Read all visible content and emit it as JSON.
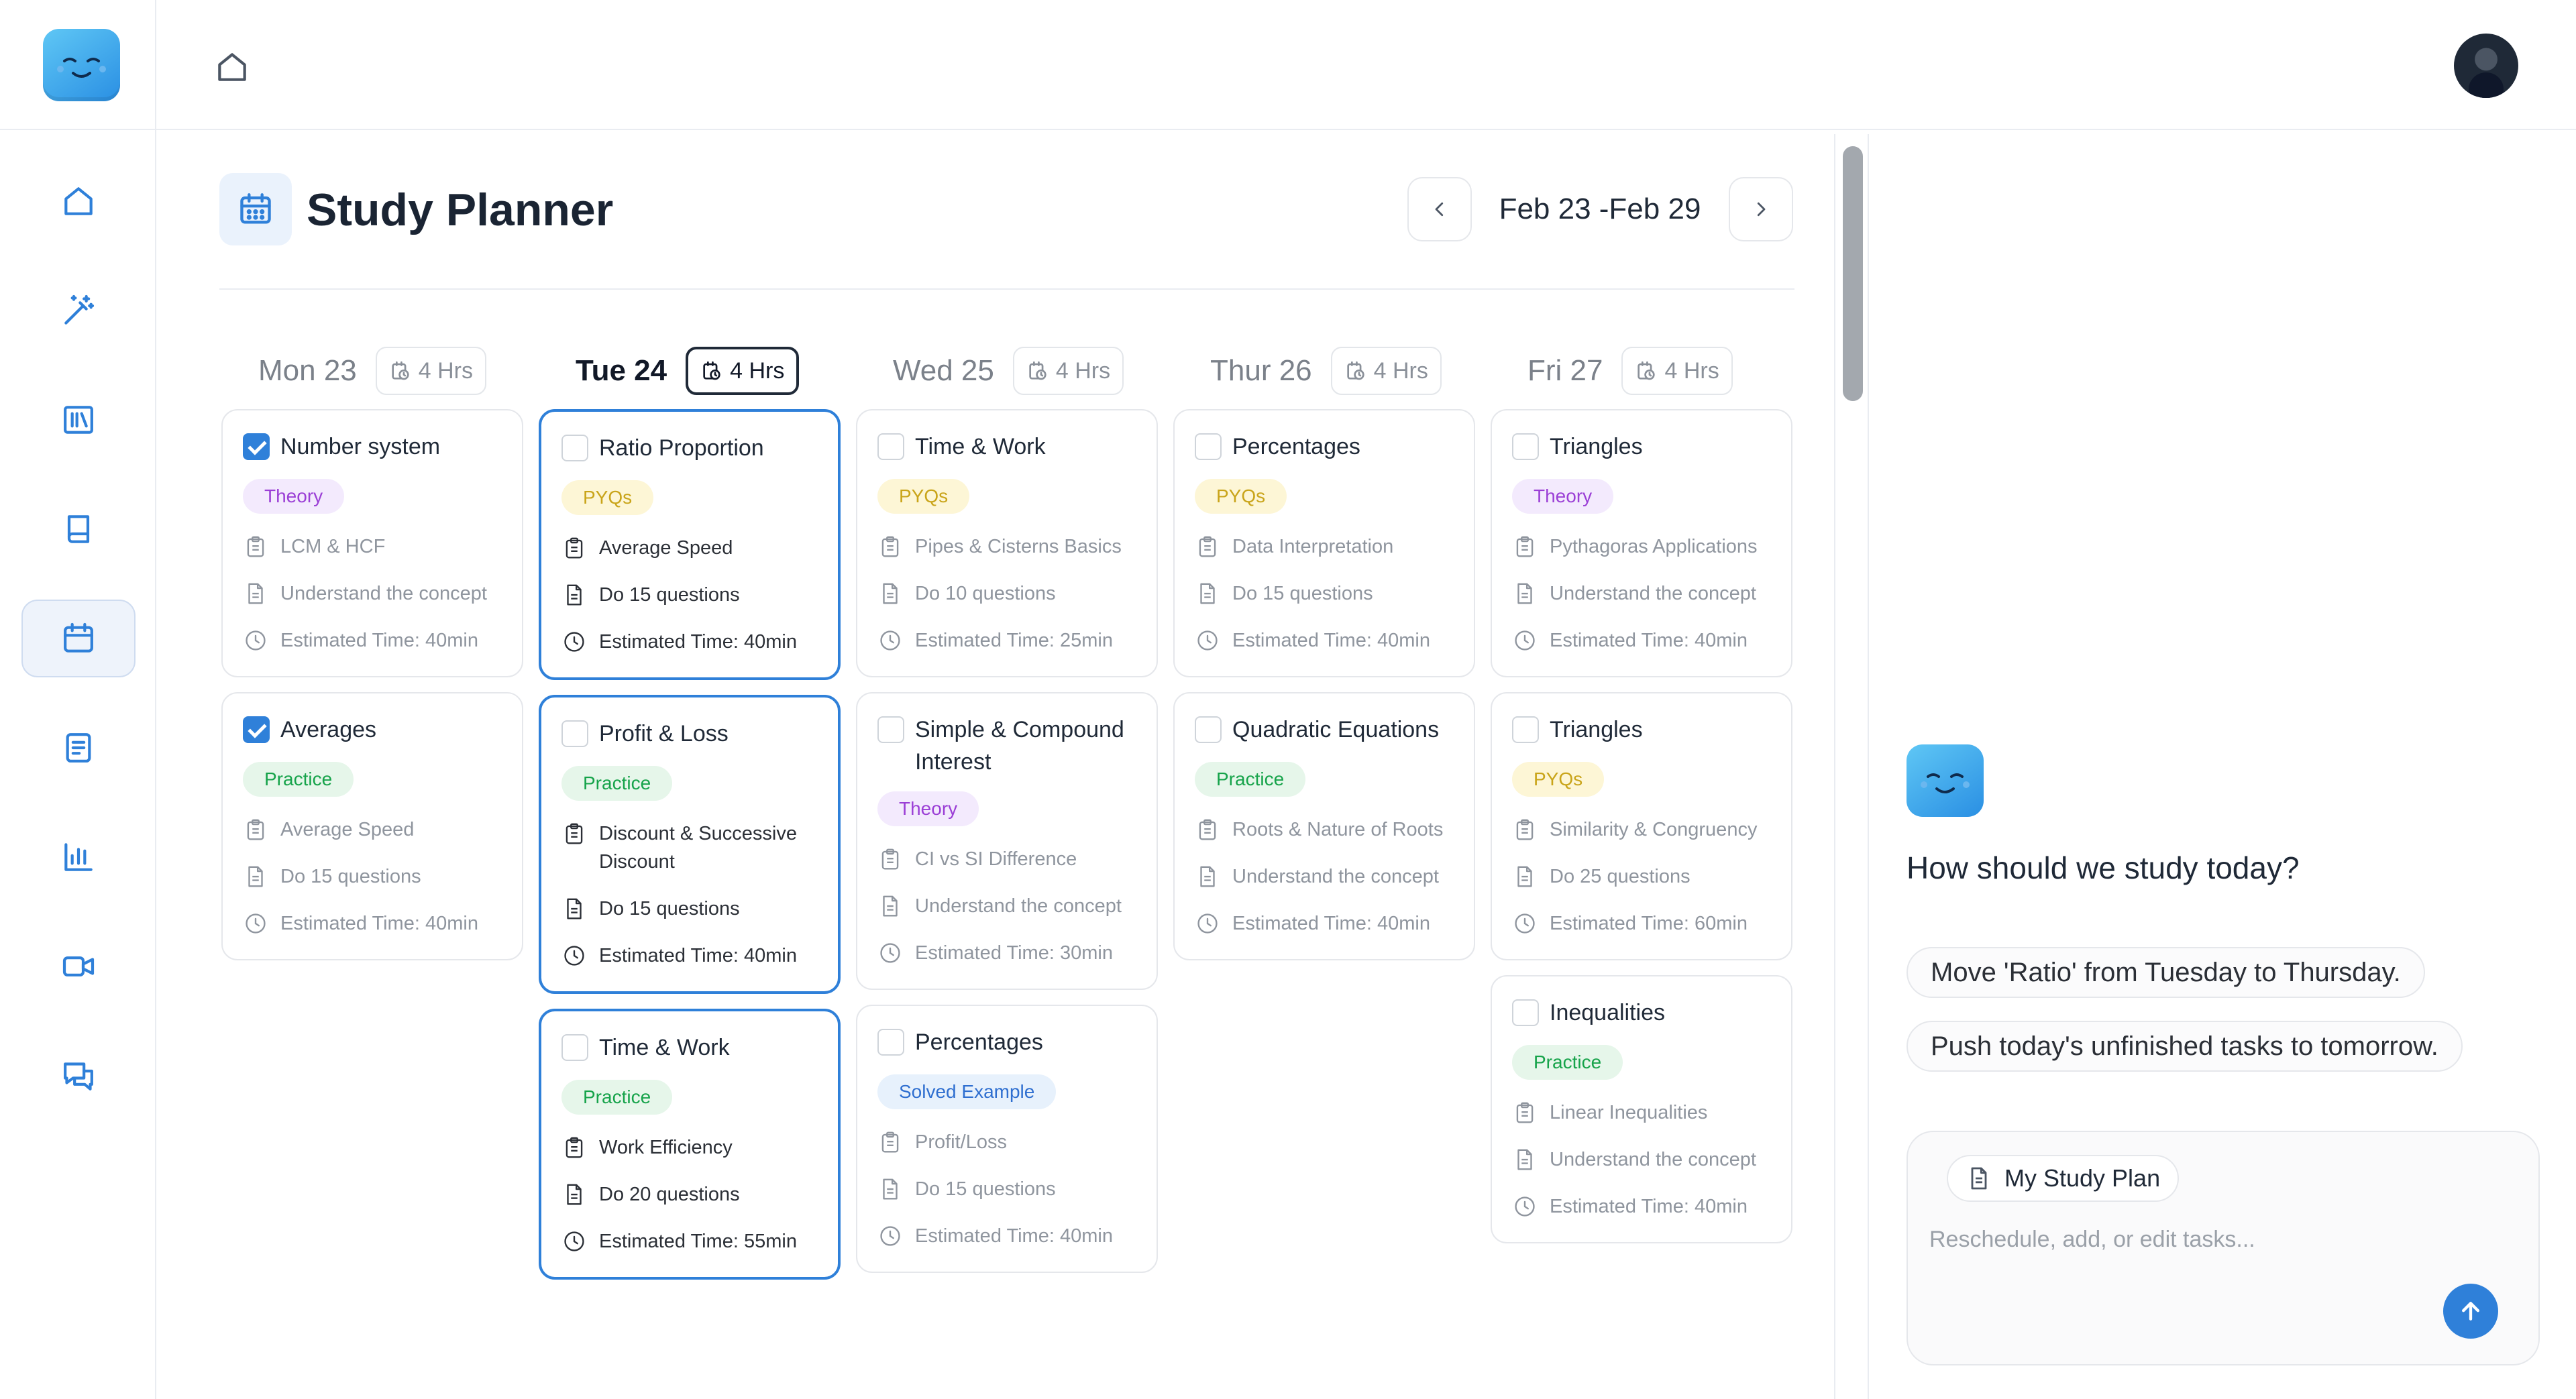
{
  "app": {
    "logo_icon": "smiling-bot-icon",
    "avatar_icon": "user-avatar-icon",
    "accent": "#2f80d9"
  },
  "header": {
    "title": "Study Planner",
    "week_range": "Feb 23 -Feb 29"
  },
  "sidebar": {
    "items": [
      {
        "name": "home",
        "icon": "home-icon",
        "active": false
      },
      {
        "name": "magic",
        "icon": "magic-wand-icon",
        "active": false
      },
      {
        "name": "library",
        "icon": "library-icon",
        "active": false
      },
      {
        "name": "book",
        "icon": "book-icon",
        "active": false
      },
      {
        "name": "calendar",
        "icon": "calendar-icon",
        "active": true
      },
      {
        "name": "notes",
        "icon": "notes-icon",
        "active": false
      },
      {
        "name": "analytics",
        "icon": "bar-chart-icon",
        "active": false
      },
      {
        "name": "video",
        "icon": "video-icon",
        "active": false
      },
      {
        "name": "chat",
        "icon": "chat-icon",
        "active": false
      }
    ]
  },
  "days": [
    {
      "label": "Mon 23",
      "hours": "4 Hrs",
      "today": false,
      "tasks": [
        {
          "title": "Number system",
          "checked": true,
          "tag": "Theory",
          "tag_kind": "theory",
          "topic": "LCM & HCF",
          "activity": "Understand the concept",
          "time": "Estimated Time: 40min"
        },
        {
          "title": "Averages",
          "checked": true,
          "tag": "Practice",
          "tag_kind": "practice",
          "topic": "Average Speed",
          "activity": "Do 15 questions",
          "time": "Estimated Time: 40min"
        }
      ]
    },
    {
      "label": "Tue 24",
      "hours": "4 Hrs",
      "today": true,
      "tasks": [
        {
          "title": "Ratio Proportion",
          "checked": false,
          "tag": "PYQs",
          "tag_kind": "pyqs",
          "topic": "Average Speed",
          "activity": "Do 15 questions",
          "time": "Estimated Time: 40min"
        },
        {
          "title": "Profit & Loss",
          "checked": false,
          "tag": "Practice",
          "tag_kind": "practice",
          "topic": "Discount & Successive Discount",
          "activity": "Do 15 questions",
          "time": "Estimated Time: 40min"
        },
        {
          "title": "Time & Work",
          "checked": false,
          "tag": "Practice",
          "tag_kind": "practice",
          "topic": "Work Efficiency",
          "activity": "Do 20 questions",
          "time": "Estimated Time: 55min"
        }
      ]
    },
    {
      "label": "Wed 25",
      "hours": "4 Hrs",
      "today": false,
      "tasks": [
        {
          "title": "Time & Work",
          "checked": false,
          "tag": "PYQs",
          "tag_kind": "pyqs",
          "topic": "Pipes & Cisterns Basics",
          "activity": "Do 10 questions",
          "time": "Estimated Time: 25min"
        },
        {
          "title": "Simple & Compound Interest",
          "checked": false,
          "tag": "Theory",
          "tag_kind": "theory",
          "topic": "CI vs SI Difference",
          "activity": "Understand the concept",
          "time": "Estimated Time: 30min"
        },
        {
          "title": "Percentages",
          "checked": false,
          "tag": "Solved Example",
          "tag_kind": "solved",
          "topic": "Profit/Loss",
          "activity": "Do 15 questions",
          "time": "Estimated Time: 40min"
        }
      ]
    },
    {
      "label": "Thur 26",
      "hours": "4 Hrs",
      "today": false,
      "tasks": [
        {
          "title": "Percentages",
          "checked": false,
          "tag": "PYQs",
          "tag_kind": "pyqs",
          "topic": "Data Interpretation",
          "activity": "Do 15 questions",
          "time": "Estimated Time: 40min"
        },
        {
          "title": "Quadratic Equations",
          "checked": false,
          "tag": "Practice",
          "tag_kind": "practice",
          "topic": "Roots & Nature of Roots",
          "activity": "Understand the concept",
          "time": "Estimated Time: 40min"
        }
      ]
    },
    {
      "label": "Fri 27",
      "hours": "4 Hrs",
      "today": false,
      "tasks": [
        {
          "title": "Triangles",
          "checked": false,
          "tag": "Theory",
          "tag_kind": "theory",
          "topic": "Pythagoras Applications",
          "activity": "Understand the concept",
          "time": "Estimated Time: 40min"
        },
        {
          "title": "Triangles",
          "checked": false,
          "tag": "PYQs",
          "tag_kind": "pyqs",
          "topic": "Similarity & Congruency",
          "activity": "Do 25 questions",
          "time": "Estimated Time: 60min"
        },
        {
          "title": "Inequalities",
          "checked": false,
          "tag": "Practice",
          "tag_kind": "practice",
          "topic": "Linear Inequalities",
          "activity": "Understand the concept",
          "time": "Estimated Time: 40min"
        }
      ]
    }
  ],
  "assistant": {
    "prompt": "How should we study today?",
    "suggestions": [
      "Move 'Ratio' from Tuesday to Thursday.",
      "Push today's unfinished tasks to tomorrow."
    ],
    "plan_chip": "My Study Plan",
    "input_placeholder": "Reschedule, add, or edit tasks...",
    "input_value": ""
  }
}
